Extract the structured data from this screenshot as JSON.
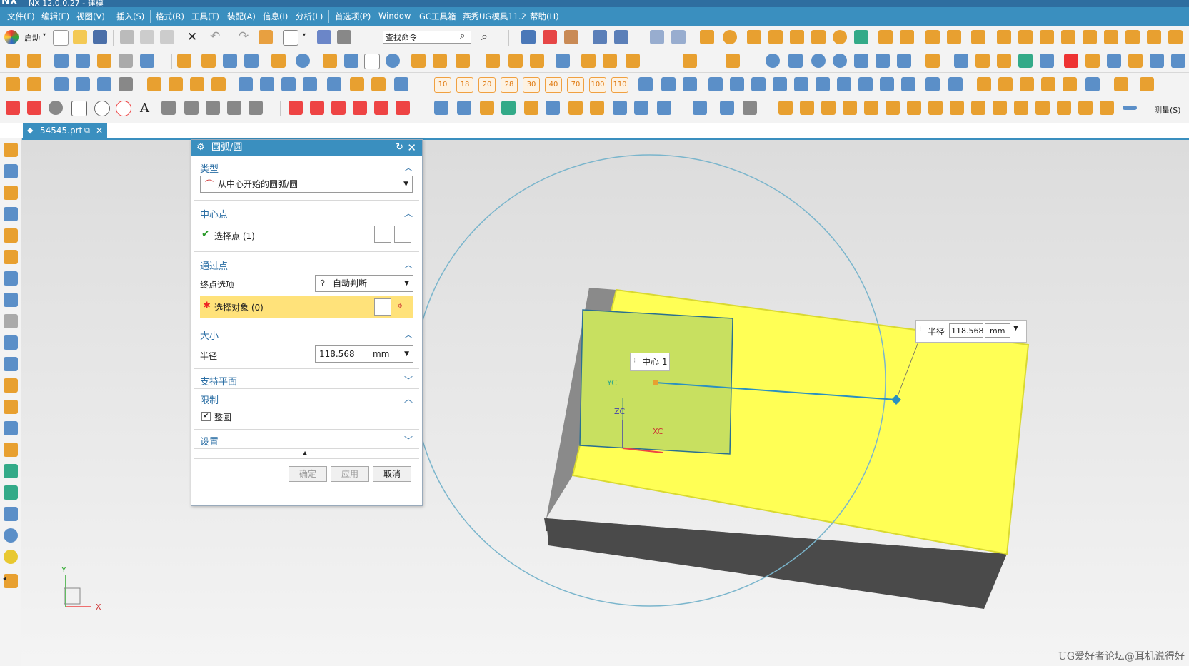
{
  "app": {
    "logo": "NX",
    "window_title": "NX 12.0.0.27 - 建模"
  },
  "menu": [
    {
      "label": "文件(F)"
    },
    {
      "label": "编辑(E)"
    },
    {
      "label": "视图(V)"
    },
    {
      "label": "插入(S)"
    },
    {
      "label": "格式(R)"
    },
    {
      "label": "工具(T)"
    },
    {
      "label": "装配(A)"
    },
    {
      "label": "信息(I)"
    },
    {
      "label": "分析(L)"
    },
    {
      "label": "首选项(P)"
    },
    {
      "label": "Window"
    },
    {
      "label": "GC工具箱"
    },
    {
      "label": "燕秀UG模具11.2"
    },
    {
      "label": "帮助(H)"
    }
  ],
  "toolbar": {
    "start_label": "启动",
    "search_placeholder": "查找命令",
    "measure_label": "测量(S)",
    "number_buttons": [
      "10",
      "18",
      "20",
      "28",
      "30",
      "40",
      "70",
      "100",
      "110"
    ]
  },
  "tab": {
    "label": "54545.prt"
  },
  "dialog": {
    "title": "圆弧/圆",
    "type_section": {
      "header": "类型",
      "value": "从中心开始的圆弧/圆"
    },
    "center_section": {
      "header": "中心点",
      "select_label": "选择点 (1)"
    },
    "through_section": {
      "header": "通过点",
      "endpoint_label": "终点选项",
      "endpoint_value": "自动判断",
      "select_label": "选择对象 (0)"
    },
    "size_section": {
      "header": "大小",
      "radius_label": "半径",
      "radius_value": "118.568",
      "unit": "mm"
    },
    "support_plane": {
      "header": "支持平面"
    },
    "limits_section": {
      "header": "限制",
      "full_circle_label": "整圆",
      "full_circle_checked": true
    },
    "settings": {
      "header": "设置"
    },
    "buttons": {
      "ok": "确定",
      "apply": "应用",
      "cancel": "取消"
    }
  },
  "viewport": {
    "center_label": "中心 1",
    "radius_label": "半径",
    "radius_value": "118.568",
    "unit": "mm",
    "triad": {
      "yc": "YC",
      "zc": "ZC",
      "xc": "XC"
    },
    "abs_axes": {
      "x": "X",
      "y": "Y"
    }
  },
  "watermark": "UG爱好者论坛@耳机说得好",
  "colors": {
    "accent": "#3a8fbf",
    "block_top": "#ffff55",
    "block_front": "#4a4a4a",
    "circle": "#7ab5cc",
    "highlight": "#ffe27a"
  }
}
